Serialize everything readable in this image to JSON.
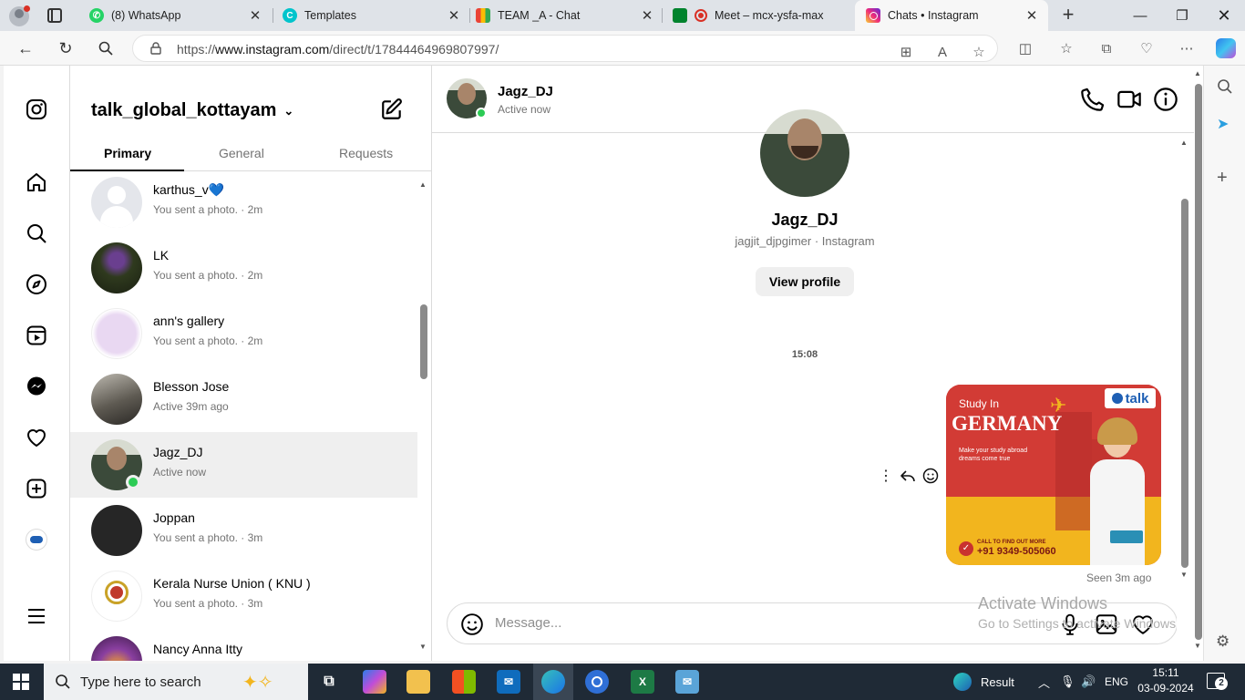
{
  "browser": {
    "tabs": [
      {
        "title": "(8) WhatsApp",
        "icon": "whatsapp-icon",
        "color": "#25d366",
        "active": false
      },
      {
        "title": "Templates",
        "icon": "canva-icon",
        "color": "#00c4cc",
        "active": false
      },
      {
        "title": "TEAM _A - Chat",
        "icon": "chat-icon",
        "color": "#1a73e8",
        "active": false
      },
      {
        "title": "Meet – mcx-ysfa-max",
        "icon": "meet-icon",
        "color": "#d93025",
        "active": false
      },
      {
        "title": "Chats • Instagram",
        "icon": "instagram-icon",
        "color": "#dd2a7b",
        "active": true
      }
    ],
    "url_prefix": "https://",
    "url_host": "www.instagram.com",
    "url_path": "/direct/t/17844464969807997/"
  },
  "sidebar": {
    "items": [
      "instagram-logo",
      "home",
      "search",
      "explore",
      "reels",
      "messages",
      "notifications",
      "create",
      "profile",
      "more"
    ]
  },
  "inbox": {
    "account": "talk_global_kottayam",
    "tabs": [
      "Primary",
      "General",
      "Requests"
    ],
    "conversations": [
      {
        "name": "karthus_v💙",
        "sub": "You sent a photo. · 2m",
        "avatar_color": "#d9dbe0",
        "selected": false,
        "online": false
      },
      {
        "name": "LK",
        "sub": "You sent a photo. · 2m",
        "avatar_color": "#2f3a1e",
        "selected": false,
        "online": false
      },
      {
        "name": "ann's gallery",
        "sub": "You sent a photo. · 2m",
        "avatar_color": "#e9d8f2",
        "selected": false,
        "online": false
      },
      {
        "name": "Blesson Jose",
        "sub": "Active 39m ago",
        "avatar_color": "#5e5a52",
        "selected": false,
        "online": false
      },
      {
        "name": "Jagz_DJ",
        "sub": "Active now",
        "avatar_color": "#3b4a3a",
        "selected": true,
        "online": true
      },
      {
        "name": "Joppan",
        "sub": "You sent a photo. · 3m",
        "avatar_color": "#262626",
        "selected": false,
        "online": false
      },
      {
        "name": "Kerala Nurse Union ( KNU )",
        "sub": "You sent a photo. · 3m",
        "avatar_color": "#ffffff",
        "selected": false,
        "online": false
      },
      {
        "name": "Nancy Anna Itty",
        "sub": "",
        "avatar_color": "#8a3fa0",
        "selected": false,
        "online": false
      }
    ]
  },
  "chat": {
    "name": "Jagz_DJ",
    "status": "Active now",
    "profile_name": "Jagz_DJ",
    "profile_handle": "jagjit_djpgimer · Instagram",
    "view_profile": "View profile",
    "timestamp": "15:08",
    "ad": {
      "line1": "Study In",
      "line2": "GERMANY",
      "line3": "Make your study abroad dreams come true",
      "cta": "CALL TO FIND OUT MORE",
      "phone": "+91 9349-505060",
      "brand": "talk"
    },
    "seen": "Seen 3m ago",
    "message_placeholder": "Message...",
    "watermark_title": "Activate Windows",
    "watermark_sub": "Go to Settings to activate Windows."
  },
  "taskbar": {
    "search_placeholder": "Type here to search",
    "weather": "Result",
    "language": "ENG",
    "time": "15:11",
    "date": "03-09-2024",
    "notifications": "2"
  }
}
